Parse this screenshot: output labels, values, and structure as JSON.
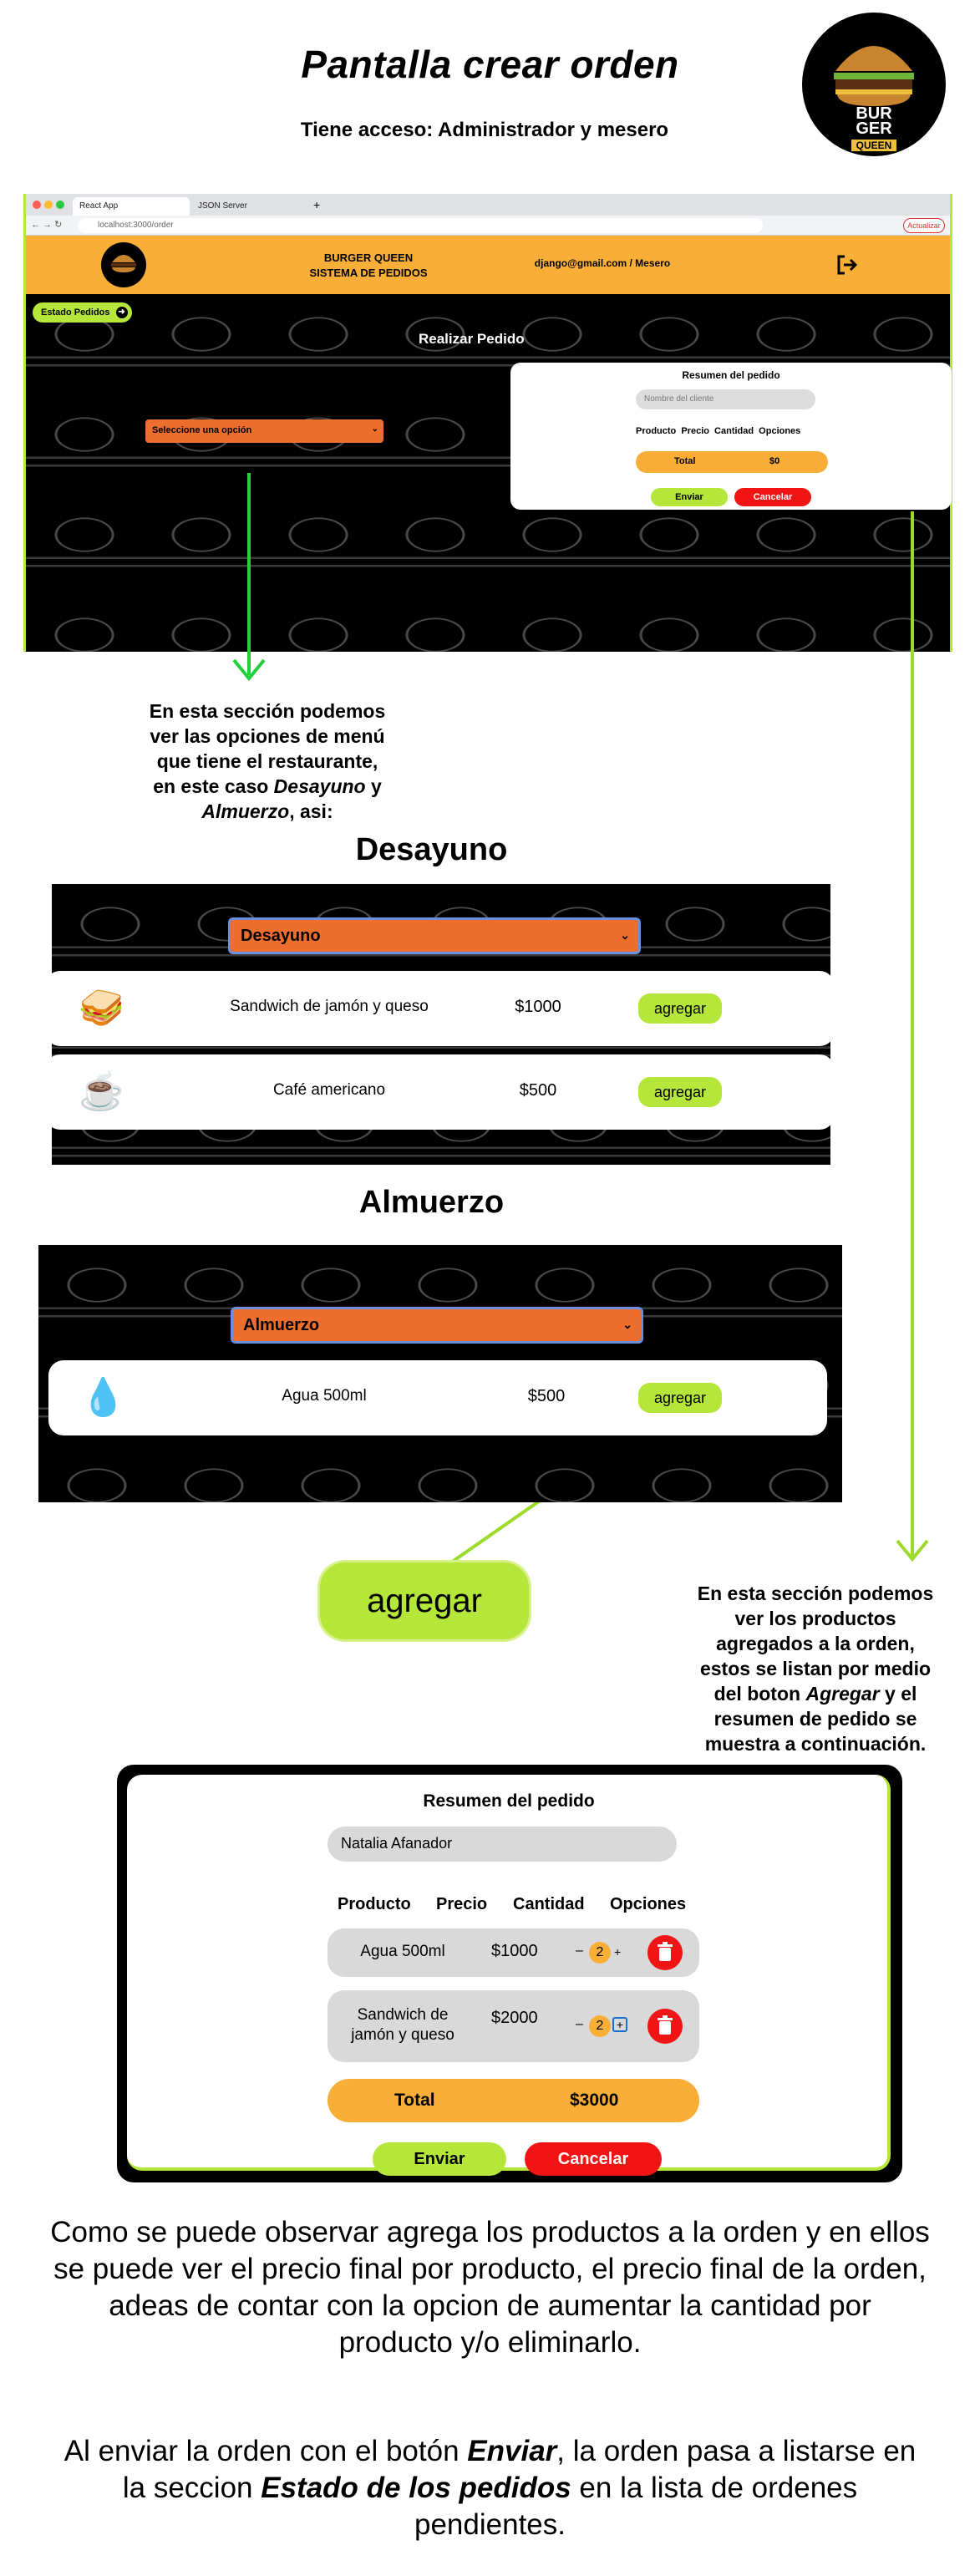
{
  "page": {
    "title": "Pantalla crear orden",
    "subtitle": "Tiene acceso: Administrador y mesero"
  },
  "logo": {
    "line1": "BUR",
    "line2": "GER",
    "line3": "QUEEN"
  },
  "browser": {
    "tab1": "React App",
    "tab2": "JSON Server",
    "url": "localhost:3000/order",
    "update_label": "Actualizar",
    "header": {
      "title_line1": "BURGER QUEEN",
      "title_line2": "SISTEMA DE PEDIDOS",
      "user": "django@gmail.com / Mesero"
    },
    "estado_btn": "Estado Pedidos",
    "realizar": "Realizar Pedido",
    "select_placeholder": "Seleccione una opción",
    "resumen": {
      "title": "Resumen del pedido",
      "client_placeholder": "Nombre del cliente",
      "col_producto": "Producto",
      "col_precio": "Precio",
      "col_cantidad": "Cantidad",
      "col_opciones": "Opciones",
      "total_label": "Total",
      "total_value": "$0",
      "enviar": "Enviar",
      "cancelar": "Cancelar"
    }
  },
  "desc_menu": {
    "l1": "En esta sección podemos",
    "l2": "ver las opciones de menú",
    "l3": "que tiene el restaurante,",
    "l4a": "en este caso ",
    "l4b": "Desayuno",
    "l4c": " y",
    "l5a": "Almuerzo",
    "l5b": ", asi:"
  },
  "desayuno": {
    "title": "Desayuno",
    "select": "Desayuno",
    "items": [
      {
        "name": "Sandwich de jamón y queso",
        "price": "$1000",
        "btn": "agregar",
        "icon": "sandwich-icon",
        "glyph": "🥪"
      },
      {
        "name": "Café americano",
        "price": "$500",
        "btn": "agregar",
        "icon": "coffee-icon",
        "glyph": "☕"
      }
    ]
  },
  "almuerzo": {
    "title": "Almuerzo",
    "select": "Almuerzo",
    "items": [
      {
        "name": "Agua 500ml",
        "price": "$500",
        "btn": "agregar",
        "icon": "water-bottle-icon",
        "glyph": "💧"
      }
    ]
  },
  "agregar_big": "agregar",
  "desc_resumen": {
    "l1": "En esta sección podemos",
    "l2": "ver los productos",
    "l3": "agregados a la orden,",
    "l4": "estos se listan por medio",
    "l5a": "del boton ",
    "l5b": "Agregar",
    "l5c": " y el",
    "l6": "resumen de pedido se",
    "l7": "muestra a continuación."
  },
  "resumen_big": {
    "title": "Resumen del pedido",
    "client": "Natalia Afanador",
    "col_producto": "Producto",
    "col_precio": "Precio",
    "col_cantidad": "Cantidad",
    "col_opciones": "Opciones",
    "rows": [
      {
        "name": "Agua 500ml",
        "price": "$1000",
        "minus": "–",
        "qty": "2",
        "plus": "+"
      },
      {
        "name_l1": "Sandwich de",
        "name_l2": "jamón y queso",
        "price": "$2000",
        "minus": "–",
        "qty": "2",
        "plus": "+"
      }
    ],
    "total_label": "Total",
    "total_value": "$3000",
    "enviar": "Enviar",
    "cancelar": "Cancelar"
  },
  "bottom": {
    "p1": "Como se puede observar agrega los productos a la orden y en ellos se puede ver el precio final por producto, el precio final de la orden, adeas de contar con la opcion de aumentar la cantidad por producto y/o eliminarlo.",
    "p2a": "Al enviar la orden con el botón ",
    "p2b": "Enviar",
    "p2c": ", la orden pasa a listarse en la seccion ",
    "p2d": "Estado de los pedidos",
    "p2e": " en la lista de ordenes pendientes."
  },
  "colors": {
    "accent_green": "#b5e73b",
    "arrow_green": "#22d03a",
    "header_orange": "#f8ae37",
    "select_orange": "#ee6e2e",
    "danger_red": "#f01414"
  }
}
